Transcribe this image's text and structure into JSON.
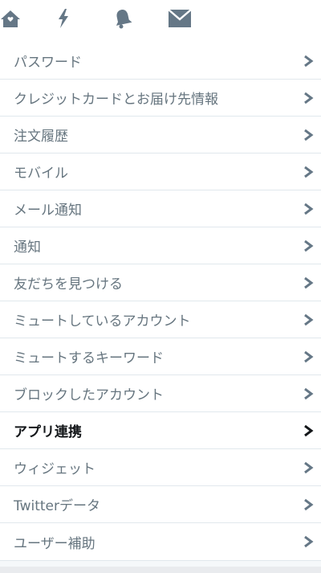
{
  "topbar": {
    "icons": [
      "home-icon",
      "lightning-icon",
      "bell-icon",
      "envelope-icon"
    ],
    "icon_color": "#657786"
  },
  "menu": {
    "items": [
      {
        "label": "パスワード"
      },
      {
        "label": "クレジットカードとお届け先情報"
      },
      {
        "label": "注文履歴"
      },
      {
        "label": "モバイル"
      },
      {
        "label": "メール通知"
      },
      {
        "label": "通知"
      },
      {
        "label": "友だちを見つける"
      },
      {
        "label": "ミュートしているアカウント"
      },
      {
        "label": "ミュートするキーワード"
      },
      {
        "label": "ブロックしたアカウント"
      },
      {
        "label": "アプリ連携",
        "active": true
      },
      {
        "label": "ウィジェット"
      },
      {
        "label": "Twitterデータ"
      },
      {
        "label": "ユーザー補助"
      }
    ]
  },
  "colors": {
    "text": "#66757f",
    "active_text": "#14171a",
    "border": "#e1e8ed",
    "chevron": "#657786",
    "active_chevron": "#14171a"
  }
}
